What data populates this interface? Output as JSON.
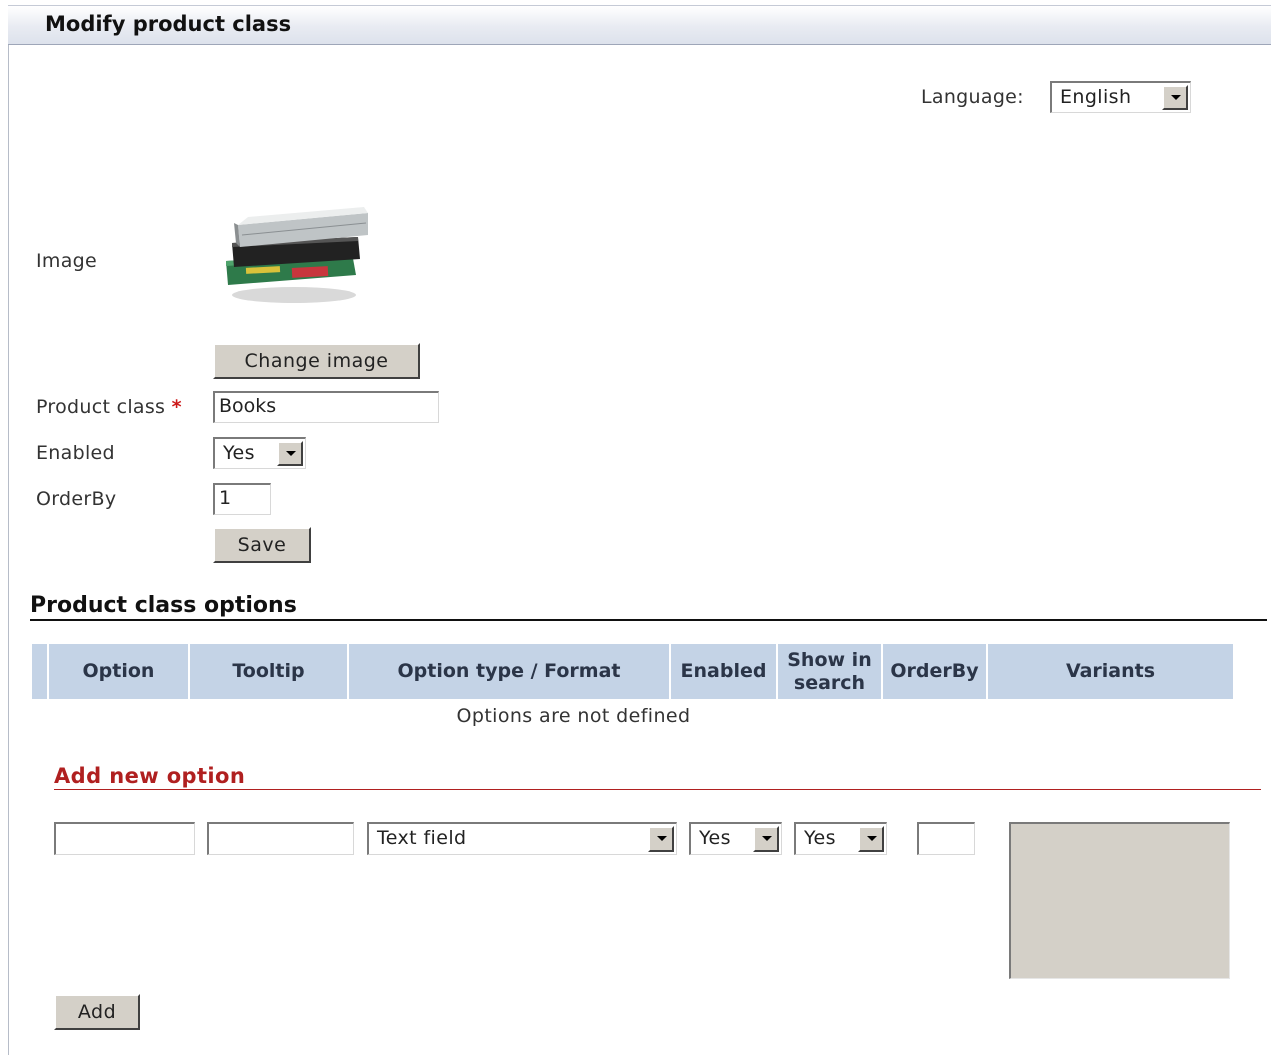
{
  "page": {
    "title": "Modify product class"
  },
  "language": {
    "label": "Language:",
    "selected": "English"
  },
  "form": {
    "image_label": "Image",
    "change_image_button": "Change image",
    "product_class_label": "Product class",
    "required_mark": "*",
    "product_class_value": "Books",
    "enabled_label": "Enabled",
    "enabled_value": "Yes",
    "orderby_label": "OrderBy",
    "orderby_value": "1",
    "save_button": "Save"
  },
  "options_section": {
    "title": "Product class options",
    "columns": [
      "Option",
      "Tooltip",
      "Option type / Format",
      "Enabled",
      "Show in search",
      "OrderBy",
      "Variants"
    ],
    "empty_message": "Options are not defined"
  },
  "add_option": {
    "title": "Add new option",
    "option_value": "",
    "tooltip_value": "",
    "type_selected": "Text field",
    "enabled_selected": "Yes",
    "show_in_search_selected": "Yes",
    "orderby_value": "",
    "variants_value": "",
    "add_button": "Add"
  },
  "icons": {
    "product_image": "books-stack-image",
    "dropdown": "chevron-down-icon"
  },
  "colors": {
    "header_blue": "#c4d3e6",
    "accent_red": "#b02020",
    "required_red": "#cc1a1a"
  }
}
